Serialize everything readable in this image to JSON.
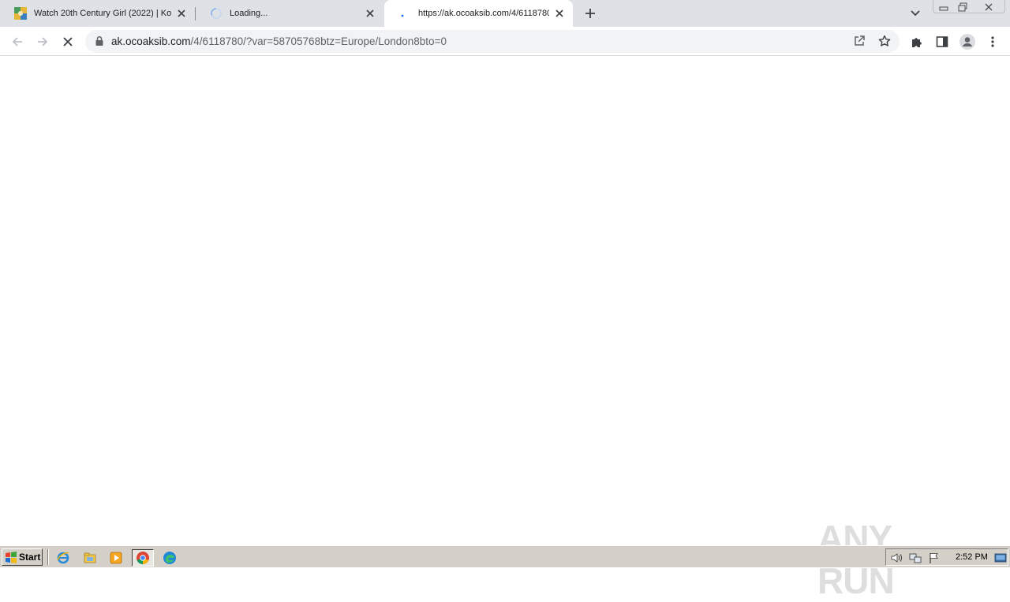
{
  "browser": {
    "tabs": [
      {
        "title": "Watch 20th Century Girl (2022) | Kor",
        "favicon": "site-icon",
        "active": false
      },
      {
        "title": "Loading...",
        "favicon": "loading-spinner-icon",
        "active": false
      },
      {
        "title": "https://ak.ocoaksib.com/4/6118780/",
        "favicon": "loading-dot-icon",
        "active": true
      }
    ],
    "address_bar": {
      "host": "ak.ocoaksib.com",
      "path": "/4/6118780/?var=58705768btz=Europe/London8bto=0"
    }
  },
  "watermark": {
    "text": "ANY RUN"
  },
  "taskbar": {
    "start_label": "Start",
    "clock": "2:52 PM",
    "quick_launch": [
      "ie-icon",
      "explorer-icon",
      "media-player-icon",
      "chrome-icon",
      "edge-icon"
    ],
    "tray_icons": [
      "volume-icon",
      "network-icon",
      "flag-icon"
    ]
  },
  "colors": {
    "tabstrip": "#dee1e6",
    "omnibox": "#f1f3f4",
    "taskbar": "#d4d0c8",
    "accent_blue": "#1a73e8"
  }
}
